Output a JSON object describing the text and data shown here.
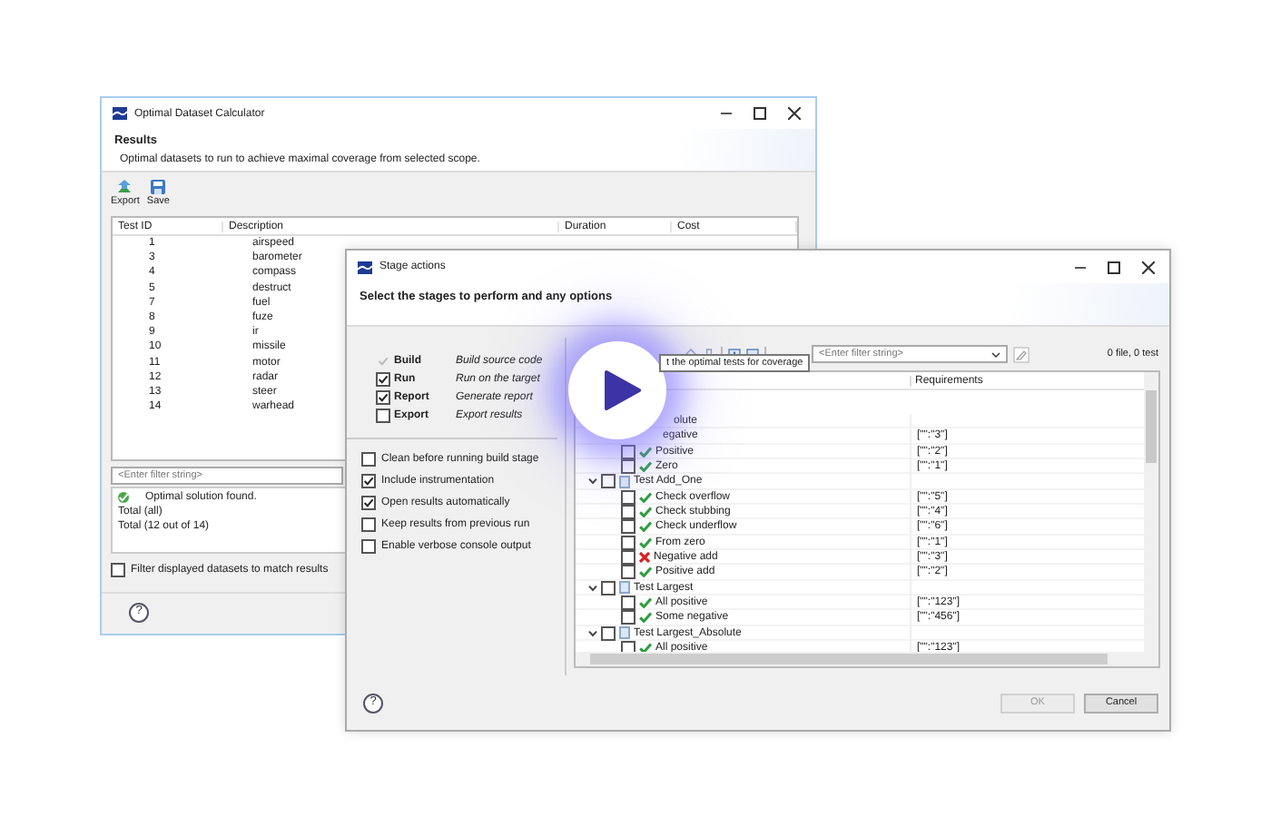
{
  "results_window": {
    "title": "Optimal Dataset Calculator",
    "heading": "Results",
    "description": "Optimal datasets to run to achieve maximal coverage from selected scope.",
    "toolbar": [
      {
        "label": "Export",
        "kind": "export"
      },
      {
        "label": "Save",
        "kind": "save"
      }
    ],
    "table": {
      "columns": [
        "Test ID",
        "Description",
        "Duration",
        "Cost"
      ],
      "rows": [
        [
          "1",
          "airspeed"
        ],
        [
          "3",
          "barometer"
        ],
        [
          "4",
          "compass"
        ],
        [
          "5",
          "destruct"
        ],
        [
          "7",
          "fuel"
        ],
        [
          "8",
          "fuze"
        ],
        [
          "9",
          "ir"
        ],
        [
          "10",
          "missile"
        ],
        [
          "11",
          "motor"
        ],
        [
          "12",
          "radar"
        ],
        [
          "13",
          "steer"
        ],
        [
          "14",
          "warhead"
        ]
      ]
    },
    "filter": {
      "placeholder": "<Enter filter string>"
    },
    "status": {
      "message": "Optimal solution found.",
      "totals": [
        "Total (all)",
        "Total (12 out of 14)"
      ]
    },
    "filter_option": {
      "label": "Filter displayed datasets to match results",
      "checked": false
    },
    "help": "?"
  },
  "stage_window": {
    "title": "Stage actions",
    "heading": "Select the stages to perform and any options",
    "stages": [
      {
        "name": "Build",
        "description": "Build source code",
        "checked": true,
        "disabled": true
      },
      {
        "name": "Run",
        "description": "Run on the target",
        "checked": true,
        "disabled": false
      },
      {
        "name": "Report",
        "description": "Generate report",
        "checked": true,
        "disabled": false
      },
      {
        "name": "Export",
        "description": "Export results",
        "checked": false,
        "disabled": false
      }
    ],
    "options": [
      {
        "label": "Clean before running build stage",
        "checked": false
      },
      {
        "label": "Include instrumentation",
        "checked": true
      },
      {
        "label": "Open results automatically",
        "checked": true
      },
      {
        "label": "Keep results from previous run",
        "checked": false
      },
      {
        "label": "Enable verbose console output",
        "checked": false
      }
    ],
    "filter": {
      "placeholder": "<Enter filter string>"
    },
    "summary": "0 file, 0 test",
    "tooltip": "t the optimal tests for coverage",
    "requirements_column": "Requirements",
    "tree": [
      {
        "kind": "partial",
        "label": "olute",
        "children": [
          {
            "kind": "partial",
            "label": "egative",
            "requirements": "[\"\":\"3\"]"
          },
          {
            "kind": "test",
            "label": "Positive",
            "checked": false,
            "passed": true,
            "requirements": "[\"\":\"2\"]"
          },
          {
            "kind": "test",
            "label": "Zero",
            "checked": false,
            "passed": true,
            "requirements": "[\"\":\"1\"]"
          }
        ]
      },
      {
        "kind": "group",
        "label": "Test Add_One",
        "checked": false,
        "expanded": true,
        "children": [
          {
            "kind": "test",
            "label": "Check overflow",
            "checked": false,
            "passed": true,
            "requirements": "[\"\":\"5\"]"
          },
          {
            "kind": "test",
            "label": "Check stubbing",
            "checked": false,
            "passed": true,
            "requirements": "[\"\":\"4\"]"
          },
          {
            "kind": "test",
            "label": "Check underflow",
            "checked": false,
            "passed": true,
            "requirements": "[\"\":\"6\"]"
          },
          {
            "kind": "test",
            "label": "From zero",
            "checked": false,
            "passed": true,
            "requirements": "[\"\":\"1\"]"
          },
          {
            "kind": "test",
            "label": "Negative add",
            "checked": false,
            "passed": false,
            "requirements": "[\"\":\"3\"]"
          },
          {
            "kind": "test",
            "label": "Positive add",
            "checked": false,
            "passed": true,
            "requirements": "[\"\":\"2\"]"
          }
        ]
      },
      {
        "kind": "group",
        "label": "Test Largest",
        "checked": false,
        "expanded": true,
        "children": [
          {
            "kind": "test",
            "label": "All positive",
            "checked": false,
            "passed": true,
            "requirements": "[\"\":\"123\"]"
          },
          {
            "kind": "test",
            "label": "Some negative",
            "checked": false,
            "passed": true,
            "requirements": "[\"\":\"456\"]"
          }
        ]
      },
      {
        "kind": "group",
        "label": "Test Largest_Absolute",
        "checked": false,
        "expanded": true,
        "children": [
          {
            "kind": "test",
            "label": "All positive",
            "checked": false,
            "passed": true,
            "requirements": "[\"\":\"123\"]"
          }
        ]
      }
    ],
    "buttons": [
      {
        "label": "OK",
        "disabled": true
      },
      {
        "label": "Cancel",
        "disabled": false
      }
    ],
    "help": "?"
  }
}
